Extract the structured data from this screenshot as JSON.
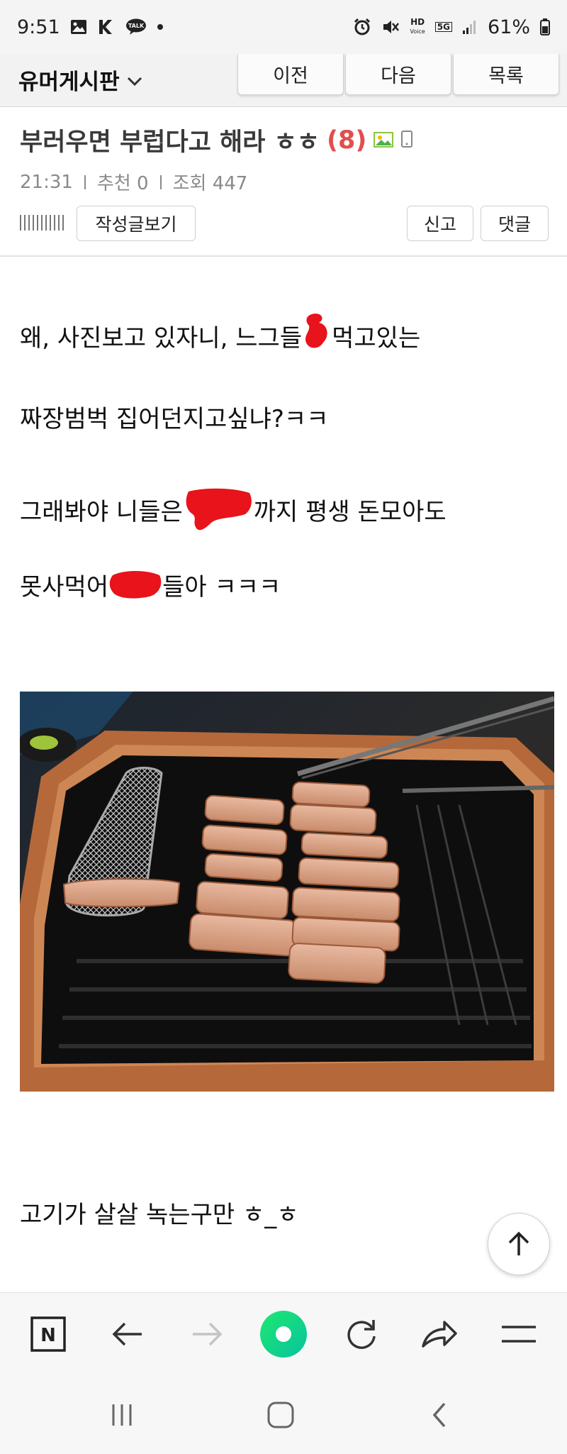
{
  "status_bar": {
    "time": "9:51",
    "battery": "61%",
    "left_icons": [
      "image-icon",
      "k-logo-icon",
      "talk-icon",
      "dot-icon"
    ],
    "talk_badge": "TALK",
    "right_icons": [
      "alarm-icon",
      "mute-icon",
      "hd-voice-icon",
      "5g-icon",
      "signal-icon",
      "battery-icon"
    ],
    "hd_label": "HD",
    "voice_label": "Voice",
    "5g_label": "5G"
  },
  "board": {
    "title": "유머게시판",
    "nav": {
      "prev": "이전",
      "next": "다음",
      "list": "목록"
    }
  },
  "post": {
    "title": "부러우면 부럽다고 해라 ㅎㅎ",
    "comment_count": "(8)",
    "time": "21:31",
    "recommend": "추천 0",
    "views": "조회 447",
    "buttons": {
      "view_posts": "작성글보기",
      "report": "신고",
      "comment": "댓글"
    },
    "lines": [
      {
        "before": "왜, 사진보고 있자니, 느그들 ",
        "after": "먹고있는"
      },
      {
        "text": "짜장범벅 집어던지고싶냐?ㅋㅋ"
      },
      {
        "before": "그래봐야 니들은 ",
        "after": "까지 평생 돈모아도"
      },
      {
        "before": "못사먹어 ",
        "after": "들아 ㅋㅋㅋ"
      }
    ],
    "redaction_color": "#e8131b",
    "caption": "고기가 살살 녹는구만 ㅎ_ㅎ"
  },
  "browser_toolbar": {
    "icons": [
      "naver-n-icon",
      "back-arrow-icon",
      "forward-arrow-icon",
      "green-home-icon",
      "refresh-icon",
      "share-icon",
      "menu-icon"
    ],
    "n_label": "N",
    "accent": "#12d27c"
  },
  "system_nav": {
    "icons": [
      "recent-apps-icon",
      "home-icon",
      "back-icon"
    ]
  }
}
